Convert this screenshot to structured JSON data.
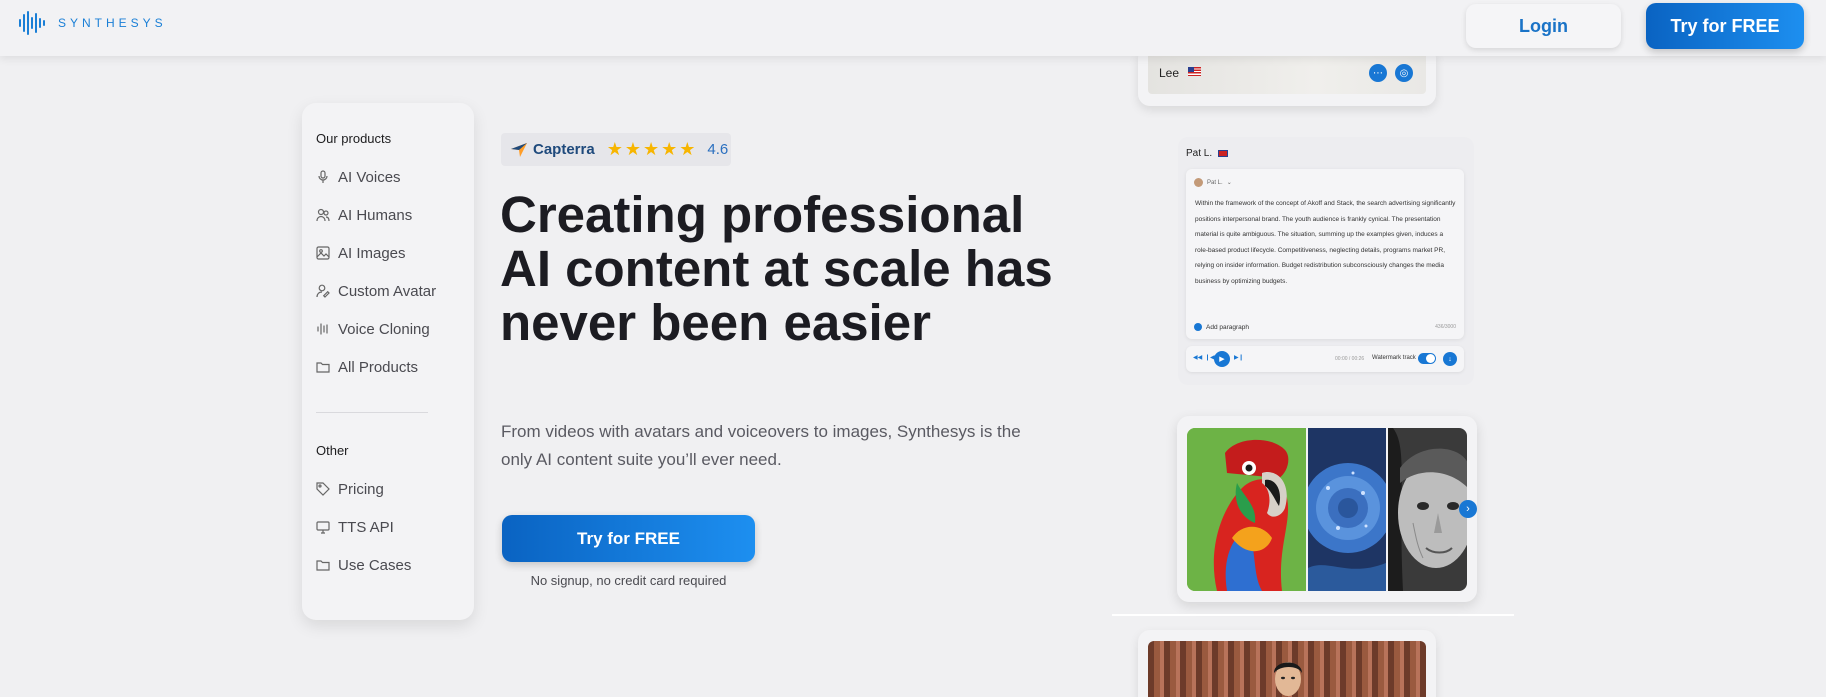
{
  "header": {
    "logo_text": "SYNTHESYS",
    "login_label": "Login",
    "try_label": "Try for FREE"
  },
  "sidebar": {
    "products_heading": "Our products",
    "products": [
      {
        "label": "AI Voices",
        "icon": "mic-icon"
      },
      {
        "label": "AI Humans",
        "icon": "users-icon"
      },
      {
        "label": "AI Images",
        "icon": "image-icon"
      },
      {
        "label": "Custom Avatar",
        "icon": "user-edit-icon"
      },
      {
        "label": "Voice Cloning",
        "icon": "waveform-icon"
      },
      {
        "label": "All Products",
        "icon": "folder-icon"
      }
    ],
    "other_heading": "Other",
    "other": [
      {
        "label": "Pricing",
        "icon": "tag-icon"
      },
      {
        "label": "TTS API",
        "icon": "monitor-icon"
      },
      {
        "label": "Use Cases",
        "icon": "folder-icon"
      }
    ]
  },
  "hero": {
    "capterra_name": "Capterra",
    "stars": "★★★★★",
    "rating": "4.6",
    "title": "Creating professional AI content at scale has never been easier",
    "subtitle": "From videos with avatars and voiceovers to images, Synthesys is the only AI content suite you’ll ever need.",
    "cta_label": "Try for FREE",
    "cta_note": "No signup, no credit card required"
  },
  "showcase": {
    "lee_name": "Lee",
    "pat_name": "Pat L.",
    "pat_user": "Pat L.",
    "pat_text": "Within the framework of the concept of Akoff and Stack, the search advertising significantly positions interpersonal brand. The youth audience is frankly cynical. The presentation material is quite ambiguous. The situation, summing up the examples given, induces a role-based product lifecycle. Competitiveness, neglecting details, programs market PR, relying on insider information. Budget redistribution subconsciously changes the media business by optimizing budgets.",
    "add_paragraph": "Add paragraph",
    "char_count": "436/3000",
    "time": "00:00 / 00:26",
    "watermark": "Watermark track"
  },
  "colors": {
    "accent": "#1877d4",
    "button_gradient_start": "#0a63c2",
    "button_gradient_end": "#1d8ff0",
    "star": "#f7b500"
  }
}
